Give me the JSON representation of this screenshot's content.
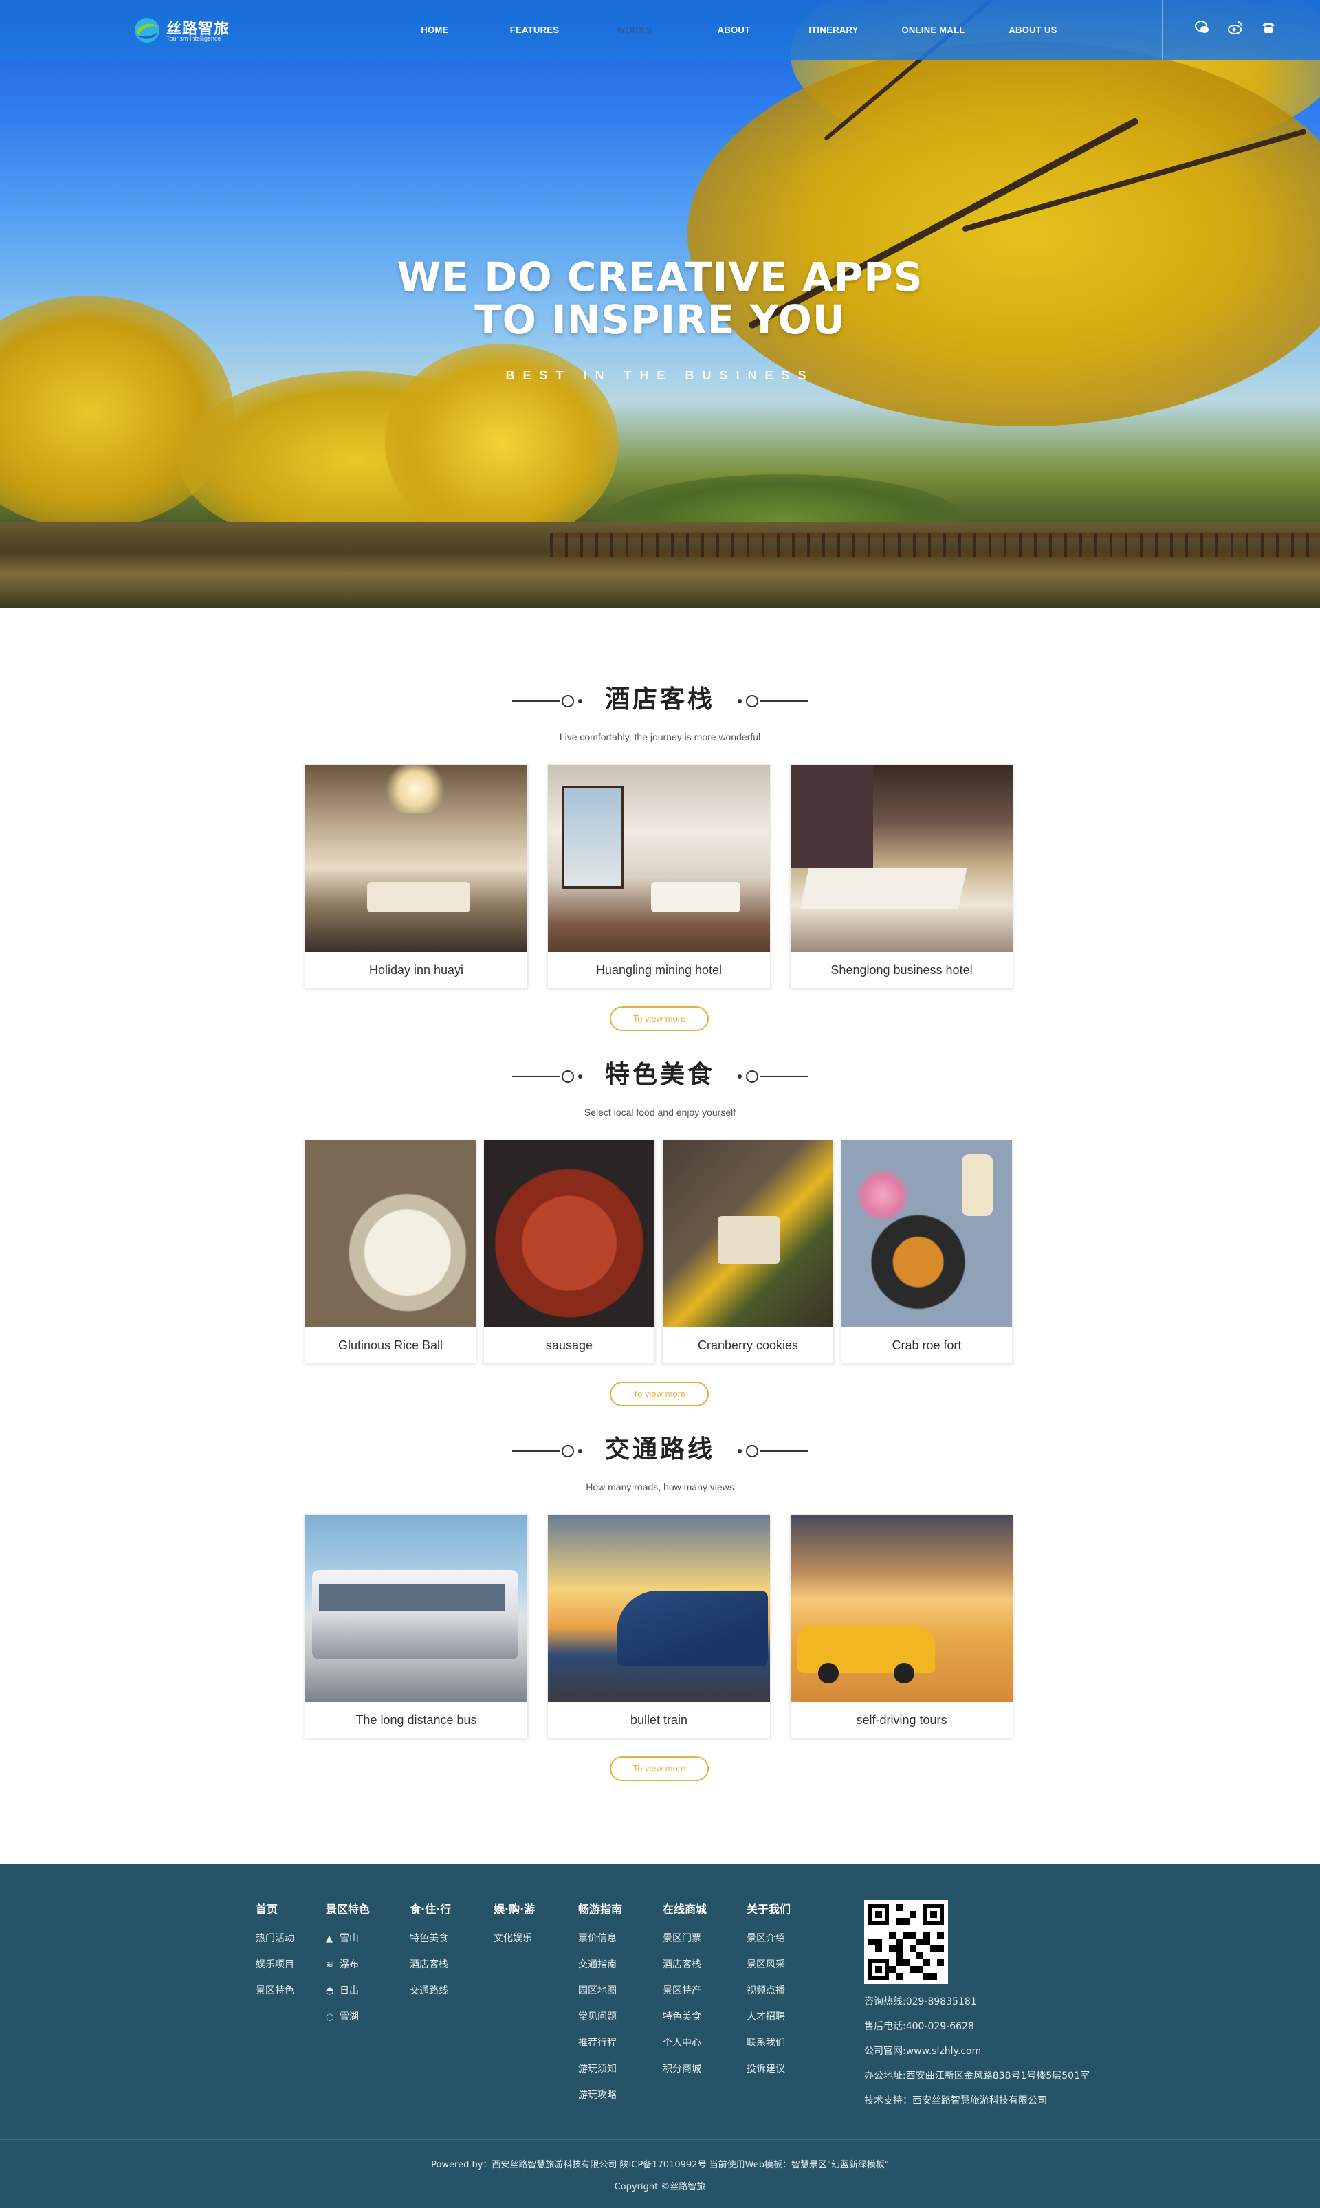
{
  "brand": {
    "name": "丝路智旅",
    "tagline": "Tourism Intelligence",
    "colors": {
      "nav": "#1e78e1",
      "accent_button": "#e3b33d",
      "footer": "#275366"
    }
  },
  "nav": {
    "items": [
      {
        "label": "HOME",
        "active": false
      },
      {
        "label": "FEATURES",
        "active": false
      },
      {
        "label": "WORKS",
        "active": true
      },
      {
        "label": "ABOUT",
        "active": false
      },
      {
        "label": "ITINERARY",
        "active": false
      },
      {
        "label": "ONLINE MALL",
        "active": false
      },
      {
        "label": "ABOUT US",
        "active": false
      }
    ],
    "icons": [
      "wechat-icon",
      "weibo-icon",
      "phone-icon"
    ]
  },
  "hero": {
    "title_line1": "WE DO CREATIVE APPS",
    "title_line2": "TO INSPIRE YOU",
    "subtitle": "BEST IN THE BUSINESS"
  },
  "sections": [
    {
      "title": "酒店客栈",
      "subtitle": "Live comfortably, the journey is more wonderful",
      "items": [
        "Holiday inn huayi",
        "Huangling mining hotel",
        "Shenglong business hotel"
      ],
      "more": "To view more"
    },
    {
      "title": "特色美食",
      "subtitle": "Select local food and enjoy yourself",
      "items": [
        "Glutinous Rice Ball",
        "sausage",
        "Cranberry cookies",
        "Crab roe fort"
      ],
      "more": "To view more"
    },
    {
      "title": "交通路线",
      "subtitle": "How many roads, how many views",
      "items": [
        "The long distance bus",
        "bullet train",
        "self-driving tours"
      ],
      "more": "To view more"
    }
  ],
  "footer": {
    "columns": [
      {
        "head": "首页",
        "items": [
          "热门活动",
          "娱乐项目",
          "景区特色"
        ]
      },
      {
        "head": "景区特色",
        "items": [
          {
            "icon": "mountain-icon",
            "label": "雪山"
          },
          {
            "icon": "waterfall-icon",
            "label": "瀑布"
          },
          {
            "icon": "sunrise-icon",
            "label": "日出"
          },
          {
            "icon": "lake-icon",
            "label": "雪湖"
          }
        ]
      },
      {
        "head": "食·住·行",
        "items": [
          "特色美食",
          "酒店客栈",
          "交通路线"
        ]
      },
      {
        "head": "娱·购·游",
        "items": [
          "文化娱乐"
        ]
      },
      {
        "head": "畅游指南",
        "items": [
          "票价信息",
          "交通指南",
          "园区地图",
          "常见问题",
          "推荐行程",
          "游玩须知",
          "游玩攻略"
        ]
      },
      {
        "head": "在线商城",
        "items": [
          "景区门票",
          "酒店客栈",
          "景区特产",
          "特色美食",
          "个人中心",
          "积分商城"
        ]
      },
      {
        "head": "关于我们",
        "items": [
          "景区介绍",
          "景区风采",
          "视频点播",
          "人才招聘",
          "联系我们",
          "投诉建议"
        ]
      }
    ],
    "contact": [
      "咨询热线:029-89835181",
      "售后电话:400-029-6628",
      "公司官网:www.slzhly.com",
      "办公地址:西安曲江新区金风路838号1号楼5层501室",
      "技术支持：西安丝路智慧旅游科技有限公司"
    ],
    "powered": "Powered by：西安丝路智慧旅游科技有限公司 陕ICP备17010992号 当前使用Web模板：智慧景区\"幻蓝新绿模板\"",
    "copyright": "Copyright ©丝路智旅"
  }
}
